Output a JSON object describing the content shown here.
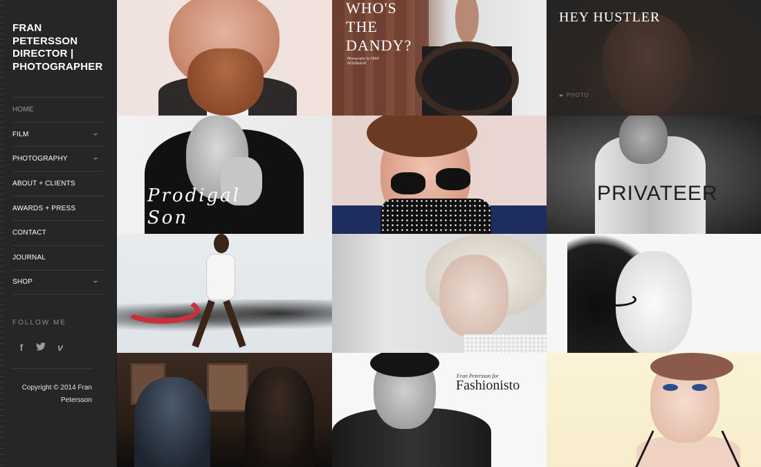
{
  "site": {
    "title": "FRAN PETERSSON DIRECTOR | PHOTOGRAPHER"
  },
  "nav": {
    "items": [
      {
        "label": "HOME",
        "active": true,
        "has_submenu": false
      },
      {
        "label": "FILM",
        "active": false,
        "has_submenu": true
      },
      {
        "label": "PHOTOGRAPHY",
        "active": false,
        "has_submenu": true
      },
      {
        "label": "ABOUT + CLIENTS",
        "active": false,
        "has_submenu": false
      },
      {
        "label": "AWARDS + PRESS",
        "active": false,
        "has_submenu": false
      },
      {
        "label": "CONTACT",
        "active": false,
        "has_submenu": false
      },
      {
        "label": "JOURNAL",
        "active": false,
        "has_submenu": false
      },
      {
        "label": "SHOP",
        "active": false,
        "has_submenu": true
      }
    ]
  },
  "follow": {
    "label": "FOLLOW ME",
    "icons": [
      "facebook-icon",
      "twitter-icon",
      "vimeo-icon"
    ]
  },
  "footer": {
    "copyright": "Copyright © 2014 Fran Petersson"
  },
  "grid": {
    "tiles": [
      {
        "id": "portrait-bearded-man"
      },
      {
        "id": "whos-the-dandy",
        "title_lines": [
          "WHO'S",
          "THE",
          "DANDY?"
        ],
        "credit": "Photography by FRAN PETERSSON"
      },
      {
        "id": "hey-hustler",
        "title": "HEY HUSTLER",
        "category": "PHOTO"
      },
      {
        "id": "prodigal-son",
        "title_lines": [
          "Prodigal",
          "Son"
        ]
      },
      {
        "id": "sunglasses-portrait"
      },
      {
        "id": "privateer",
        "title": "PRIVATEER"
      },
      {
        "id": "dancer"
      },
      {
        "id": "blonde-portrait"
      },
      {
        "id": "bw-woman"
      },
      {
        "id": "film-still"
      },
      {
        "id": "fashionisto",
        "small": "Fran Petersson for",
        "big": "Fashionisto"
      },
      {
        "id": "blue-eyes-portrait"
      }
    ]
  },
  "colors": {
    "sidebar_bg": "#262626",
    "nav_text": "#ffffff",
    "nav_active": "#9a9a9a",
    "divider": "#3b3b3b"
  }
}
